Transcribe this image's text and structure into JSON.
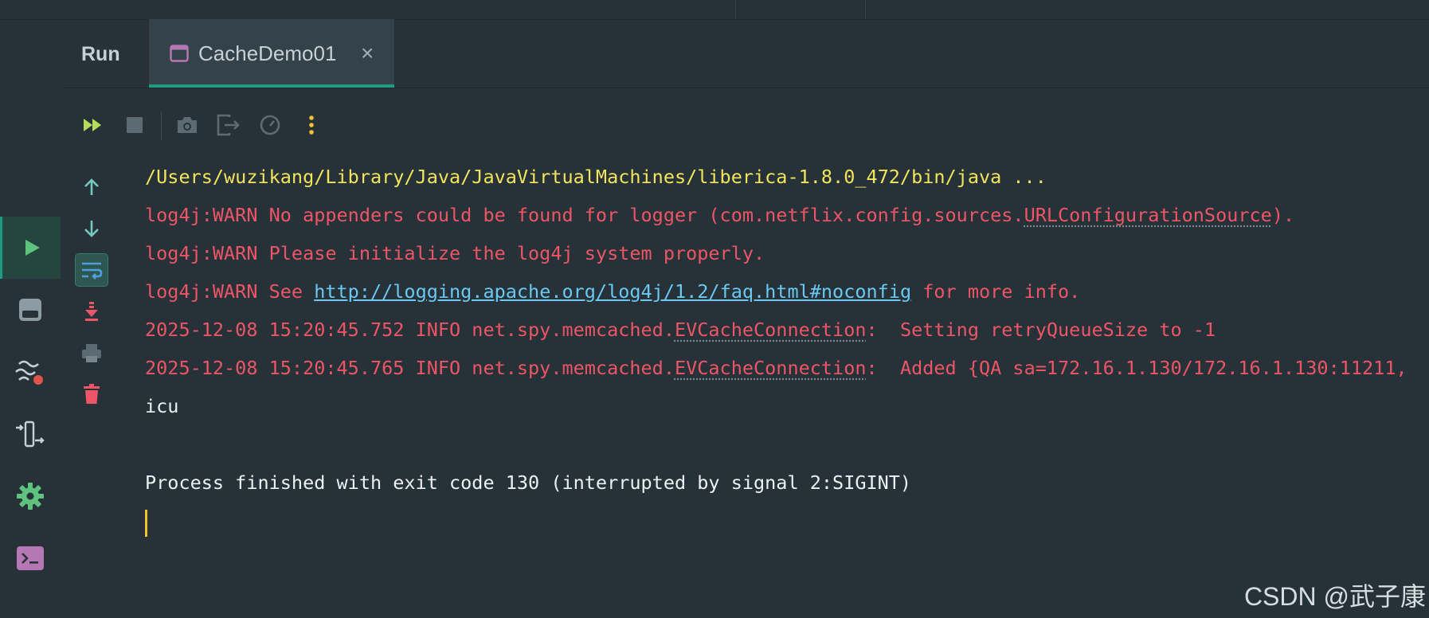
{
  "tool_window": {
    "title": "Run",
    "tab": {
      "label": "CacheDemo01",
      "close_glyph": "×"
    }
  },
  "toolbar": {
    "rerun": "rerun-icon",
    "stop": "stop-icon",
    "screenshot": "camera-icon",
    "exit": "exit-icon",
    "coverage": "gauge-icon",
    "more": "more-vertical-icon"
  },
  "sidebar": {
    "items": [
      "run-icon",
      "archive-icon",
      "profiler-icon",
      "attach-icon",
      "settings-icon",
      "terminal-icon"
    ],
    "active": "run-icon"
  },
  "console": {
    "line1": "/Users/wuzikang/Library/Java/JavaVirtualMachines/liberica-1.8.0_472/bin/java ...",
    "line2_a": "log4j:WARN No appenders could be found for logger (com.netflix.config.sources.",
    "line2_b": "URLConfigurationSource",
    "line2_c": ").",
    "line3": "log4j:WARN Please initialize the log4j system properly.",
    "line4_a": "log4j:WARN See ",
    "line4_link": "http://logging.apache.org/log4j/1.2/faq.html#noconfig",
    "line4_c": " for more info.",
    "line5_a": "2025-12-08 15:20:45.752 INFO net.spy.memcached.",
    "line5_b": "EVCacheConnection",
    "line5_c": ":  Setting retryQueueSize to -1",
    "line6_a": "2025-12-08 15:20:45.765 INFO net.spy.memcached.",
    "line6_b": "EVCacheConnection",
    "line6_c": ":  Added {QA sa=172.16.1.130/172.16.1.130:11211,",
    "line7": "icu",
    "line8": "Process finished with exit code 130 (interrupted by signal 2:SIGINT)"
  },
  "watermark": "CSDN @武子康",
  "colors": {
    "background": "#263238",
    "accent": "#1e9b82",
    "warn": "#ee5567",
    "command": "#f2e45d",
    "link": "#6bc8f2"
  }
}
